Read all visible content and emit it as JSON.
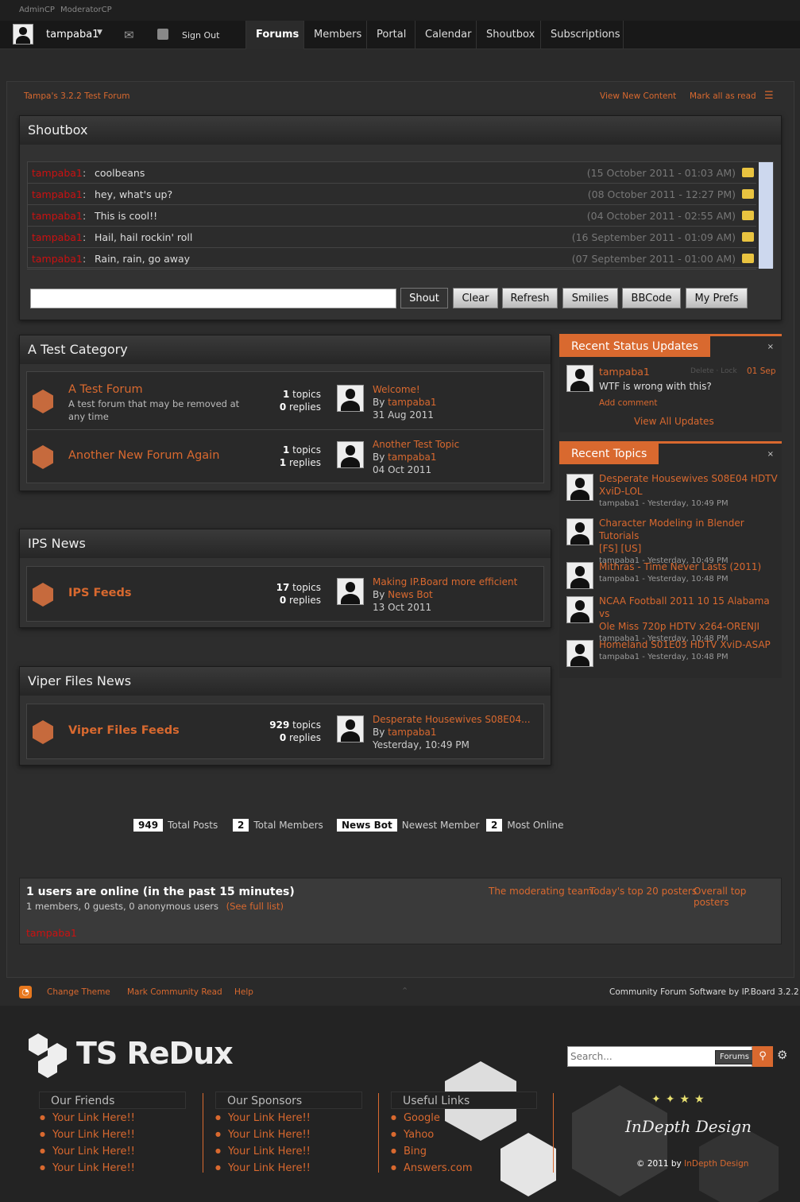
{
  "top": {
    "admin": "AdminCP",
    "mod": "ModeratorCP"
  },
  "nav": {
    "user": "tampaba1",
    "signout": "Sign Out",
    "tabs": [
      "Forums",
      "Members",
      "Portal",
      "Calendar",
      "Shoutbox",
      "Subscriptions"
    ]
  },
  "crumb": {
    "home": "Tampa's 3.2.2 Test Forum",
    "new": "View New Content",
    "read": "Mark all as read"
  },
  "shoutbox": {
    "title": "Shoutbox",
    "rows": [
      {
        "user": "tampaba1",
        "msg": "coolbeans",
        "time": "(15 October 2011 - 01:03 AM)"
      },
      {
        "user": "tampaba1",
        "msg": "hey, what's up?",
        "time": "(08 October 2011 - 12:27 PM)"
      },
      {
        "user": "tampaba1",
        "msg": "This is cool!!",
        "time": "(04 October 2011 - 02:55 AM)"
      },
      {
        "user": "tampaba1",
        "msg": "Hail, hail rockin' roll",
        "time": "(16 September 2011 - 01:09 AM)"
      },
      {
        "user": "tampaba1",
        "msg": "Rain, rain, go away",
        "time": "(07 September 2011 - 01:00 AM)"
      }
    ],
    "buttons": [
      "Shout",
      "Clear",
      "Refresh",
      "Smilies",
      "BBCode",
      "My Prefs"
    ]
  },
  "cat1": {
    "title": "A Test Category",
    "f1": {
      "name": "A Test Forum",
      "desc": "A test forum that may be removed at any time",
      "topics": "1",
      "replies": "0",
      "lp": "Welcome!",
      "by": "tampaba1",
      "date": "31 Aug 2011"
    },
    "f2": {
      "name": "Another New Forum Again",
      "topics": "1",
      "replies": "1",
      "lp": "Another Test Topic",
      "by": "tampaba1",
      "date": "04 Oct 2011"
    }
  },
  "cat2": {
    "title": "IPS News",
    "f1": {
      "name": "IPS Feeds",
      "topics": "17",
      "replies": "0",
      "lp": "Making IP.Board more efficient",
      "by": "News Bot",
      "date": "13 Oct 2011"
    }
  },
  "cat3": {
    "title": "Viper Files News",
    "f1": {
      "name": "Viper Files Feeds",
      "topics": "929",
      "replies": "0",
      "lp": "Desperate Housewives S08E04...",
      "by": "tampaba1",
      "date": "Yesterday, 10:49 PM"
    }
  },
  "labels": {
    "topics": "topics",
    "replies": "replies",
    "by": "By"
  },
  "status": {
    "title": "Recent Status Updates",
    "user": "tampaba1",
    "actions": "Delete · Lock",
    "date": "01 Sep",
    "text": "WTF is wrong with this?",
    "add": "Add comment",
    "all": "View All Updates"
  },
  "recent": {
    "title": "Recent Topics",
    "items": [
      {
        "t1": "Desperate Housewives S08E04 HDTV",
        "t2": "XviD-LOL",
        "meta": "tampaba1 - Yesterday, 10:49 PM"
      },
      {
        "t1": "Character Modeling in Blender Tutorials",
        "t2": "[FS] [US]",
        "meta": "tampaba1 - Yesterday, 10:49 PM"
      },
      {
        "t1": "Mithras - Time Never Lasts (2011)",
        "t2": "",
        "meta": "tampaba1 - Yesterday, 10:48 PM"
      },
      {
        "t1": "NCAA Football 2011 10 15 Alabama vs",
        "t2": "Ole Miss 720p HDTV x264-ORENJI",
        "meta": "tampaba1 - Yesterday, 10:48 PM"
      },
      {
        "t1": "Homeland S01E03 HDTV XviD-ASAP",
        "t2": "",
        "meta": "tampaba1 - Yesterday, 10:48 PM"
      }
    ]
  },
  "stats": {
    "posts": "949",
    "posts_l": "Total Posts",
    "members": "2",
    "members_l": "Total Members",
    "newest": "News Bot",
    "newest_l": "Newest Member",
    "online": "2",
    "online_l": "Most Online"
  },
  "online": {
    "title": "1 users are online (in the past 15 minutes)",
    "sub": "1 members, 0 guests, 0 anonymous users",
    "full": "(See full list)",
    "user": "tampaba1",
    "l1": "The moderating team",
    "l2": "Today's top 20 posters",
    "l3": "Overall top posters"
  },
  "footer": {
    "theme": "Change Theme",
    "mark": "Mark Community Read",
    "help": "Help",
    "credit": "Community Forum Software by IP.Board 3.2.2"
  },
  "brand": {
    "logo": "TS ReDux",
    "search_ph": "Search...",
    "scope": "Forums",
    "design": "InDepth Design",
    "copy": "© 2011 by",
    "copylink": "InDepth Design"
  },
  "links": {
    "friends": "Our Friends",
    "sponsors": "Our Sponsors",
    "useful": "Useful Links",
    "item": "Your Link Here!!",
    "u": [
      "Google",
      "Yahoo",
      "Bing",
      "Answers.com"
    ]
  },
  "colors": {
    "accent": "#d9692f",
    "shout_user": "#cc1111"
  }
}
